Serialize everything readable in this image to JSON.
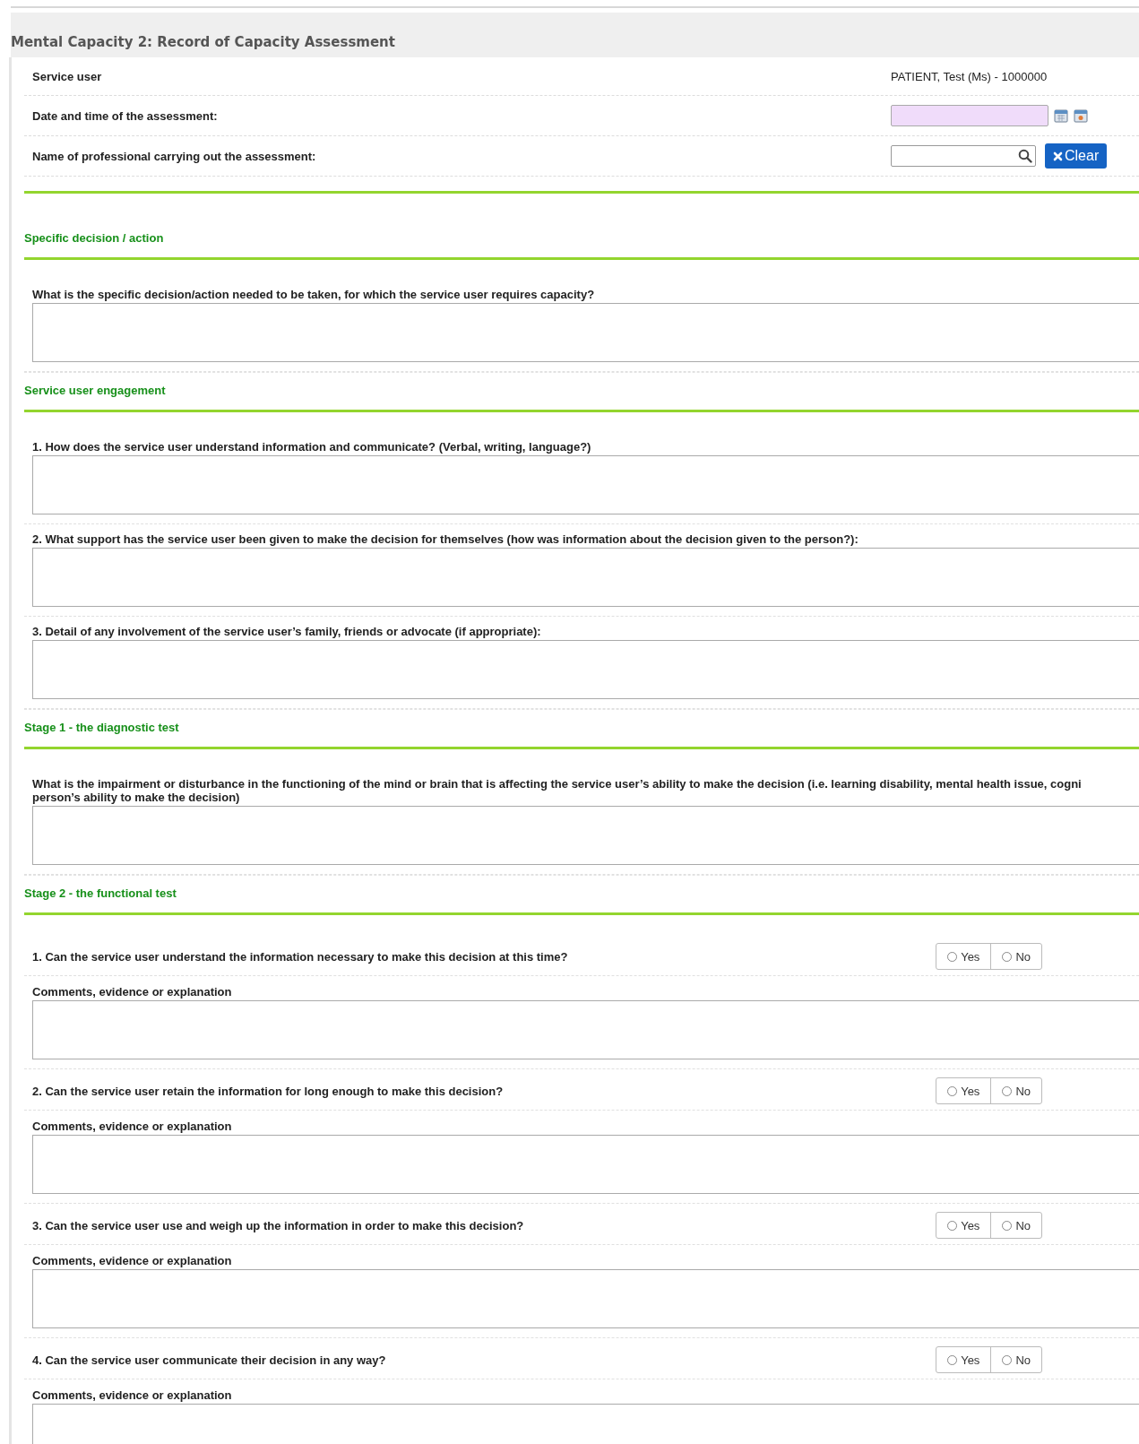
{
  "title": "Mental Capacity 2: Record of Capacity Assessment",
  "header_fields": [
    {
      "kind": "text",
      "label": "Service user",
      "value": "PATIENT, Test (Ms) - 1000000"
    },
    {
      "kind": "date",
      "label": "Date and time of the assessment:"
    },
    {
      "kind": "lookup",
      "label": "Name of professional carrying out the assessment:",
      "button": "Clear"
    }
  ],
  "sections": [
    {
      "heading": "Specific decision / action",
      "items": [
        {
          "kind": "textarea",
          "question_lines": [
            "What is the specific decision/action needed to be taken, for which the service user requires capacity?"
          ]
        }
      ]
    },
    {
      "heading": "Service user engagement",
      "items": [
        {
          "kind": "textarea",
          "question_lines": [
            "1. How does the service user understand information and communicate? (Verbal, writing, language?)"
          ]
        },
        {
          "kind": "textarea",
          "question_lines": [
            "2. What support has the service user been given to make the decision for themselves (how was information about the decision given to the person?):"
          ]
        },
        {
          "kind": "textarea",
          "question_lines": [
            "3. Detail of any involvement of the service user’s family, friends or advocate (if appropriate):"
          ]
        }
      ]
    },
    {
      "heading": "Stage 1 - the diagnostic test",
      "items": [
        {
          "kind": "textarea",
          "question_lines": [
            "What is the impairment or disturbance in the functioning of the mind or brain that is affecting the service user’s ability to make the decision (i.e. learning disability, mental health issue, cogni",
            "person’s ability to make the decision)"
          ]
        }
      ]
    },
    {
      "heading": "Stage 2 - the functional test",
      "items": [
        {
          "kind": "yesno",
          "question": "1. Can the service user understand the information necessary to make this decision at this time?",
          "options": [
            {
              "label": "Yes",
              "selected": false
            },
            {
              "label": "No",
              "selected": false
            }
          ],
          "comment_label": "Comments, evidence or explanation"
        },
        {
          "kind": "yesno",
          "question": "2. Can the service user retain the information for long enough to make this decision?",
          "options": [
            {
              "label": "Yes",
              "selected": false
            },
            {
              "label": "No",
              "selected": false
            }
          ],
          "comment_label": "Comments, evidence or explanation"
        },
        {
          "kind": "yesno",
          "question": "3. Can the service user use and weigh up the information in order to make this decision?",
          "options": [
            {
              "label": "Yes",
              "selected": false
            },
            {
              "label": "No",
              "selected": false
            }
          ],
          "comment_label": "Comments, evidence or explanation"
        },
        {
          "kind": "yesno",
          "question": "4. Can the service user communicate their decision in any way?",
          "options": [
            {
              "label": "Yes",
              "selected": false
            },
            {
              "label": "No",
              "selected": false
            }
          ],
          "comment_label": "Comments, evidence or explanation"
        }
      ]
    }
  ]
}
